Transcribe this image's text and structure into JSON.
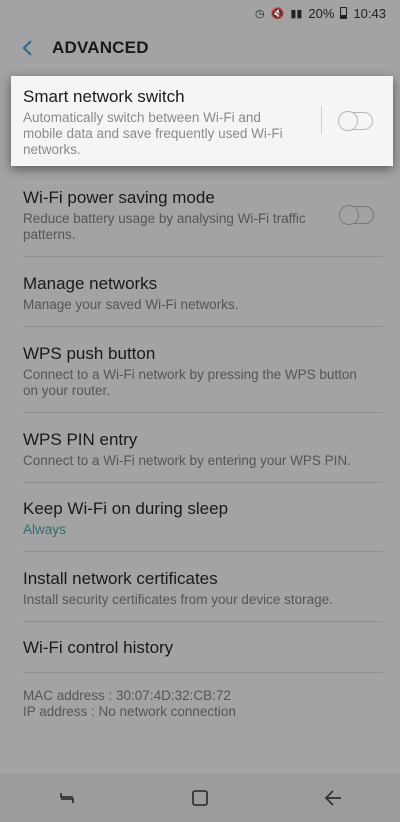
{
  "status_bar": {
    "battery": "20%",
    "time": "10:43"
  },
  "header": {
    "title": "ADVANCED"
  },
  "smart_switch": {
    "title": "Smart network switch",
    "subtitle": "Automatically switch between Wi-Fi and mobile data and save frequently used Wi-Fi networks.",
    "enabled": false
  },
  "items": [
    {
      "title": "Wi-Fi power saving mode",
      "subtitle": "Reduce battery usage by analysing Wi-Fi traffic patterns.",
      "toggle": false
    },
    {
      "title": "Manage networks",
      "subtitle": "Manage your saved Wi-Fi networks."
    },
    {
      "title": "WPS push button",
      "subtitle": "Connect to a Wi-Fi network by pressing the WPS button on your router."
    },
    {
      "title": "WPS PIN entry",
      "subtitle": "Connect to a Wi-Fi network by entering your WPS PIN."
    },
    {
      "title": "Keep Wi-Fi on during sleep",
      "subtitle": "Always"
    },
    {
      "title": "Install network certificates",
      "subtitle": "Install security certificates from your device storage."
    },
    {
      "title": "Wi-Fi control history"
    }
  ],
  "info": {
    "mac": "MAC address : 30:07:4D:32:CB:72",
    "ip": "IP address : No network connection"
  },
  "nav": {
    "recents": "recents-icon",
    "home": "home-icon",
    "back": "back-icon"
  },
  "colors": {
    "dim_background": "#a3a3a3",
    "card": "#f5f5f5",
    "accent_text": "#2f6e72",
    "back_arrow": "#2a6f8f"
  }
}
